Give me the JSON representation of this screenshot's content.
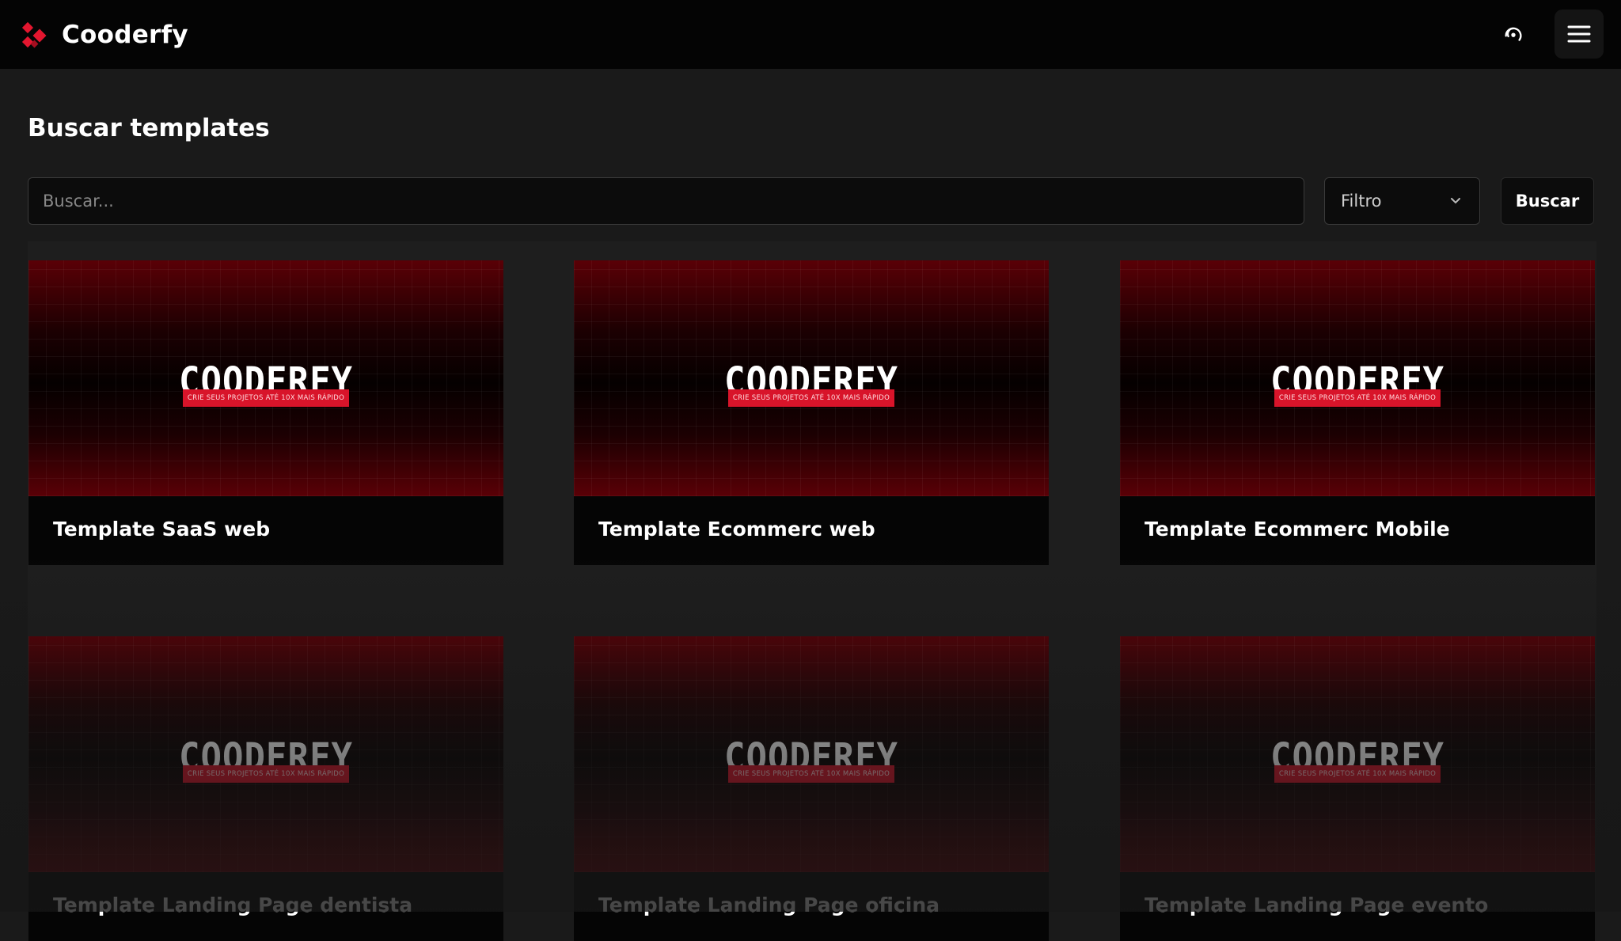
{
  "header": {
    "brand_name": "Cooderfy",
    "icons": {
      "logo": "cooderfy-logo-icon",
      "theme": "theme-toggle-icon",
      "menu": "hamburger-menu-icon"
    },
    "accent_color": "#e3162f"
  },
  "main": {
    "title": "Buscar templates",
    "search": {
      "placeholder": "Buscar...",
      "value": ""
    },
    "filter": {
      "selected": "Filtro"
    },
    "search_button": "Buscar"
  },
  "templates": [
    {
      "title": "Template SaaS web",
      "thumb_word": "COODERFY",
      "thumb_tagline": "CRIE SEUS PROJETOS ATÉ 10X MAIS RÁPIDO"
    },
    {
      "title": "Template Ecommerc web",
      "thumb_word": "COODERFY",
      "thumb_tagline": "CRIE SEUS PROJETOS ATÉ 10X MAIS RÁPIDO"
    },
    {
      "title": "Template Ecommerc Mobile",
      "thumb_word": "COODERFY",
      "thumb_tagline": "CRIE SEUS PROJETOS ATÉ 10X MAIS RÁPIDO"
    },
    {
      "title": "Template Landing Page dentista",
      "thumb_word": "COODERFY",
      "thumb_tagline": "CRIE SEUS PROJETOS ATÉ 10X MAIS RÁPIDO"
    },
    {
      "title": "Template Landing Page oficina",
      "thumb_word": "COODERFY",
      "thumb_tagline": "CRIE SEUS PROJETOS ATÉ 10X MAIS RÁPIDO"
    },
    {
      "title": "Template Landing Page evento",
      "thumb_word": "COODERFY",
      "thumb_tagline": "CRIE SEUS PROJETOS ATÉ 10X MAIS RÁPIDO"
    }
  ]
}
